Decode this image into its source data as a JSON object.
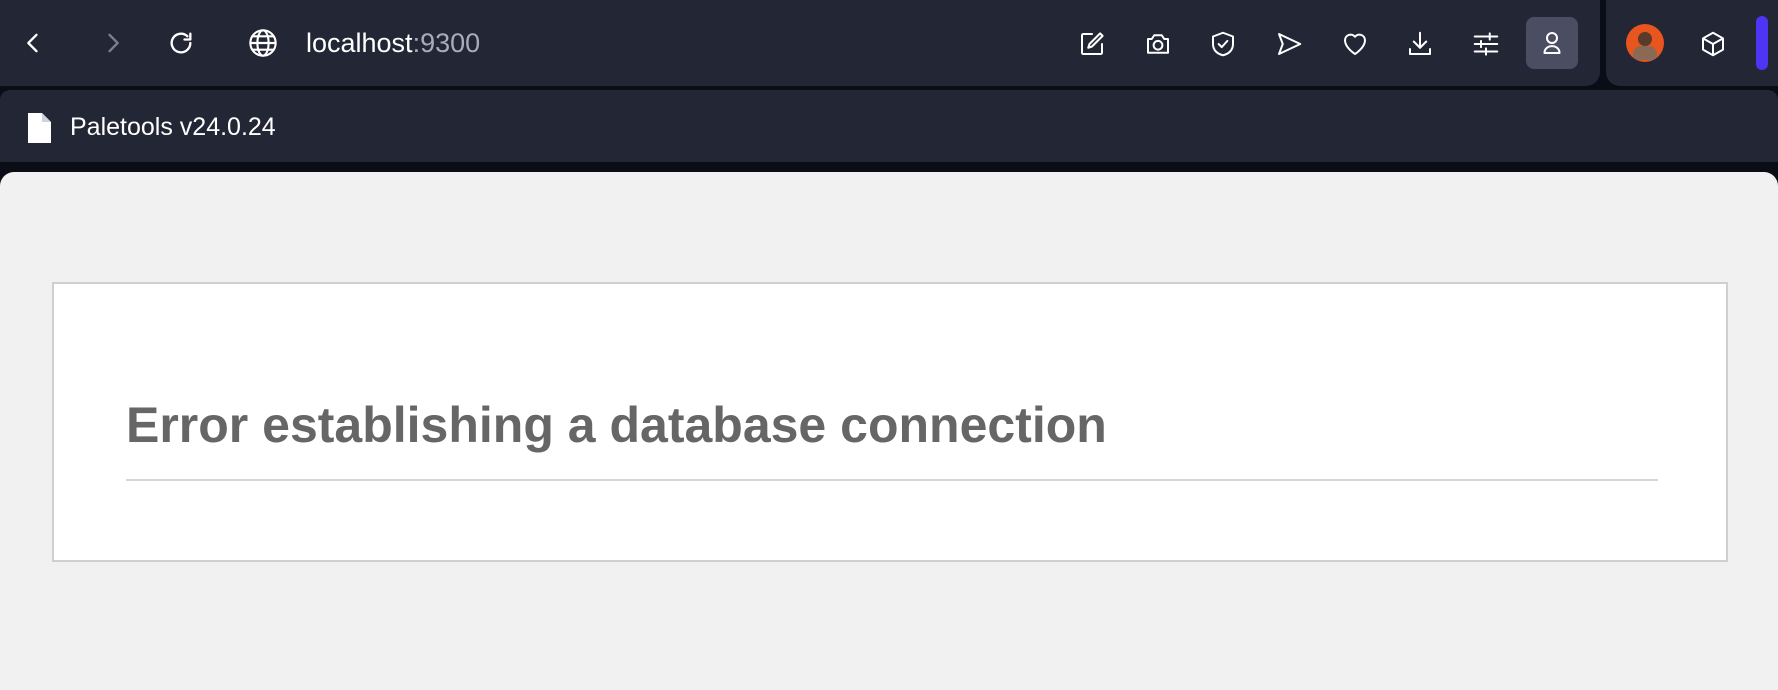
{
  "browser": {
    "url_host": "localhost",
    "url_port": ":9300",
    "tab_title": "Paletools v24.0.24",
    "accent_color": "#4e34f5",
    "toolbar_icons": [
      "edit-icon",
      "camera-icon",
      "shield-icon",
      "send-icon",
      "heart-icon",
      "download-icon",
      "sliders-icon",
      "profile-icon"
    ],
    "extension_icons": [
      "avatar",
      "cube-icon"
    ]
  },
  "page": {
    "error_title": "Error establishing a database connection"
  }
}
